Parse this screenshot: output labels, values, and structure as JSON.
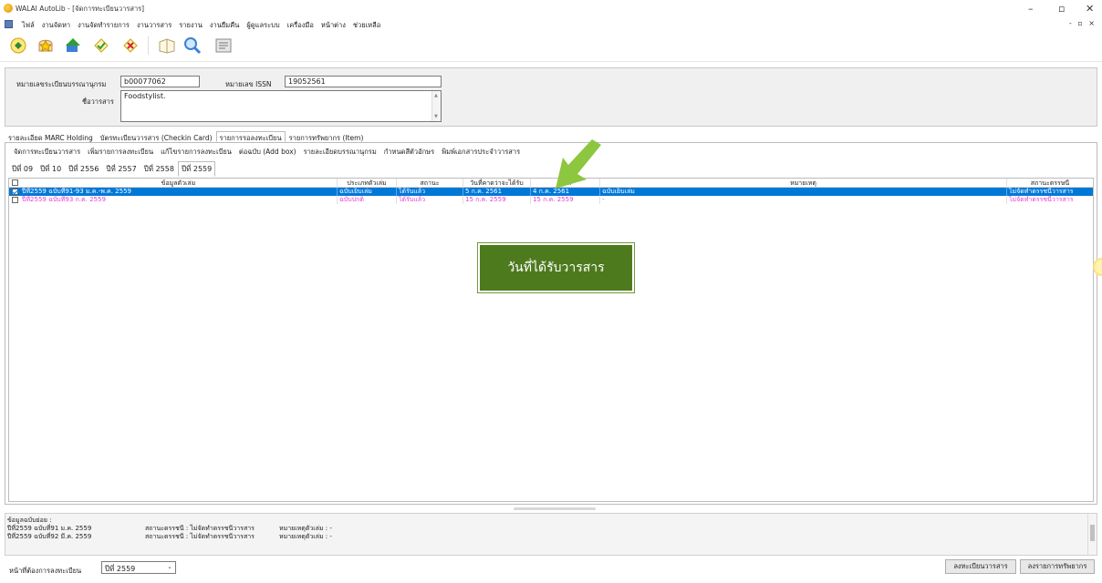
{
  "window": {
    "title": "WALAI AutoLib - [จัดการทะเบียนวารสาร]",
    "minimize": "–",
    "maximize": "▫",
    "close": "✕",
    "mdi_controls": "- ▫ ×"
  },
  "menu": {
    "items": [
      "ไฟล์",
      "งานจัดหา",
      "งานจัดทำรายการ",
      "งานวารสาร",
      "รายงาน",
      "งานยืมคืน",
      "ผู้ดูแลระบบ",
      "เครื่องมือ",
      "หน้าต่าง",
      "ช่วยเหลือ"
    ]
  },
  "toolbar": {
    "icons": [
      "new-icon",
      "bookmark-star-icon",
      "check-arrow-icon",
      "approve-icon",
      "cancel-icon",
      "open-book-icon",
      "search-icon",
      "report-icon"
    ]
  },
  "form": {
    "control_label": "หมายเลขระเบียนบรรณานุกรม",
    "control_value": "b00077062",
    "issn_label": "หมายเลข ISSN",
    "issn_value": "19052561",
    "title_label": "ชื่อวารสาร",
    "title_value": "Foodstylist."
  },
  "main_tabs": [
    {
      "label": "รายละเอียด MARC Holding"
    },
    {
      "label": "บัตรทะเบียนวารสาร (Checkin Card)"
    },
    {
      "label": "รายการรอลงทะเบียน"
    },
    {
      "label": "รายการทรัพยากร (Item)"
    }
  ],
  "links": [
    "จัดการทะเบียนวารสาร",
    "เพิ่มรายการลงทะเบียน",
    "แก้ไขรายการลงทะเบียน",
    "ต่อฉบับ (Add box)",
    "รายละเอียดบรรณานุกรม",
    "กำหนดสีตัวอักษร",
    "พิมพ์เอกสารประจำวารสาร"
  ],
  "year_tabs": [
    "ปีที่ 09",
    "ปีที่ 10",
    "ปีที่ 2556",
    "ปีที่ 2557",
    "ปีที่ 2558",
    "ปีที่ 2559"
  ],
  "grid": {
    "headers": {
      "issue": "ข้อมูลตัวเล่ม",
      "type": "ประเภทตัวเล่ม",
      "status": "สถานะ",
      "expected": "วันที่คาดว่าจะได้รับ",
      "received": "วันที่",
      "note": "หมายเหตุ",
      "bind_status": "สถานะตรรษนี"
    },
    "rows": [
      {
        "issue": "ปีที่2559 ฉบับที่91-93 ม.ค.-พ.ค. 2559",
        "type": "ฉบับเย็บเล่ม",
        "status": "ได้รับแล้ว",
        "expected": "5 ก.ค. 2561",
        "received": "4 ก.ค. 2561",
        "note": "ฉบับเย็บเล่ม",
        "bind_status": "ไม่จัดทำดรรชนีวารสาร"
      },
      {
        "issue": "ปีที่2559 ฉบับที่93 ก.ค. 2559",
        "type": "ฉบับปกติ",
        "status": "ได้รับแล้ว",
        "expected": "15 ก.ค. 2559",
        "received": "15 ก.ค. 2559",
        "note": "-",
        "bind_status": "ไม่จัดทำดรรชนีวารสาร"
      }
    ]
  },
  "annotation": {
    "text": "วันที่ได้รับวารสาร",
    "arrow_color": "#8dc63f",
    "box_color": "#4e7a1e"
  },
  "info": {
    "heading": "ข้อมูลฉบับย่อย :",
    "lines": [
      {
        "issue": "ปีที่2559 ฉบับที่91 ม.ค. 2559",
        "status": "สถานะดรรชนี : ไม่จัดทำดรรชนีวารสาร",
        "note": "หมายเหตุตัวเล่ม : -"
      },
      {
        "issue": "ปีที่2559 ฉบับที่92 มี.ค. 2559",
        "status": "สถานะดรรชนี : ไม่จัดทำดรรชนีวารสาร",
        "note": "หมายเหตุตัวเล่ม : -"
      }
    ]
  },
  "footer": {
    "label": "หน้าที่ต้องการลงทะเบียน",
    "select_value": "ปีที่ 2559",
    "button1": "ลงทะเบียนวารสาร",
    "button2": "ลงรายการทรัพยากร"
  },
  "colors": {
    "selected_row": "#0078d7",
    "pink_text": "#e040e0"
  }
}
